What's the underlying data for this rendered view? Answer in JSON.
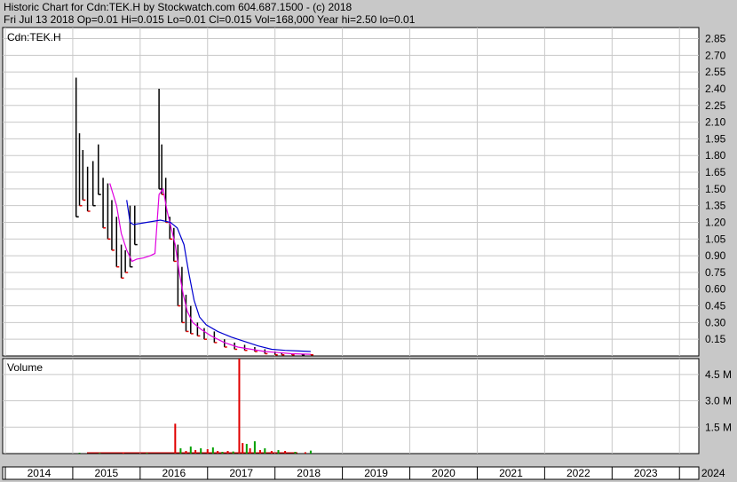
{
  "header": {
    "line1": "Historic Chart for Cdn:TEK.H by Stockwatch.com 604.687.1500 - (c) 2018",
    "line2": "Fri Jul 13 2018   Op=0.01   Hi=0.015   Lo=0.01   Cl=0.015   Vol=168,000   Year hi=2.50   lo=0.01"
  },
  "colors": {
    "background": "#c8c8c8",
    "panel": "#ffffff",
    "grid": "#c8c8c8",
    "price": "#000000",
    "down_tick": "#e00000",
    "ma_short": "#e000e0",
    "ma_long": "#0000d0",
    "vol_up": "#00a000",
    "vol_down": "#e00000"
  },
  "chart_data": [
    {
      "type": "line",
      "title": "Cdn:TEK.H",
      "xlabel": "",
      "ylabel": "",
      "x_ticks": [
        "2014",
        "2015",
        "2016",
        "2017",
        "2018",
        "2019",
        "2020",
        "2021",
        "2022",
        "2023",
        "2024"
      ],
      "y_ticks": [
        "2.85",
        "2.70",
        "2.55",
        "2.40",
        "2.25",
        "2.10",
        "1.95",
        "1.80",
        "1.65",
        "1.50",
        "1.35",
        "1.20",
        "1.05",
        "0.90",
        "0.75",
        "0.60",
        "0.45",
        "0.30",
        "0.15"
      ],
      "ylim": [
        0,
        2.95
      ],
      "grid": true,
      "series": [
        {
          "values_kind": "price_hilo",
          "points": [
            [
              2015.05,
              1.25,
              2.5
            ],
            [
              2015.1,
              1.35,
              2.0
            ],
            [
              2015.15,
              1.4,
              1.85
            ],
            [
              2015.22,
              1.3,
              1.7
            ],
            [
              2015.3,
              1.35,
              1.75
            ],
            [
              2015.38,
              1.45,
              1.9
            ],
            [
              2015.45,
              1.15,
              1.6
            ],
            [
              2015.52,
              1.05,
              1.55
            ],
            [
              2015.58,
              0.95,
              1.4
            ],
            [
              2015.65,
              0.8,
              1.25
            ],
            [
              2015.72,
              0.7,
              1.0
            ],
            [
              2015.78,
              0.75,
              0.95
            ],
            [
              2015.85,
              0.8,
              1.35
            ],
            [
              2015.92,
              1.0,
              1.35
            ],
            [
              2016.28,
              1.5,
              2.4
            ],
            [
              2016.32,
              1.45,
              1.9
            ],
            [
              2016.38,
              1.2,
              1.6
            ],
            [
              2016.44,
              1.05,
              1.25
            ],
            [
              2016.5,
              0.85,
              1.15
            ],
            [
              2016.56,
              0.45,
              1.0
            ],
            [
              2016.62,
              0.3,
              0.8
            ],
            [
              2016.68,
              0.22,
              0.55
            ],
            [
              2016.75,
              0.2,
              0.45
            ],
            [
              2016.85,
              0.18,
              0.3
            ],
            [
              2016.95,
              0.15,
              0.25
            ],
            [
              2017.1,
              0.12,
              0.22
            ],
            [
              2017.25,
              0.08,
              0.15
            ],
            [
              2017.4,
              0.06,
              0.12
            ],
            [
              2017.55,
              0.05,
              0.1
            ],
            [
              2017.7,
              0.04,
              0.08
            ],
            [
              2017.85,
              0.02,
              0.06
            ],
            [
              2018.0,
              0.01,
              0.04
            ],
            [
              2018.1,
              0.01,
              0.03
            ],
            [
              2018.25,
              0.01,
              0.02
            ],
            [
              2018.4,
              0.01,
              0.02
            ],
            [
              2018.53,
              0.01,
              0.015
            ]
          ]
        },
        {
          "name": "",
          "role": "ma_short",
          "points": [
            [
              2015.55,
              1.55
            ],
            [
              2015.65,
              1.35
            ],
            [
              2015.72,
              1.1
            ],
            [
              2015.8,
              0.95
            ],
            [
              2015.88,
              0.85
            ],
            [
              2015.95,
              0.87
            ],
            [
              2016.05,
              0.88
            ],
            [
              2016.15,
              0.9
            ],
            [
              2016.22,
              0.92
            ],
            [
              2016.28,
              1.45
            ],
            [
              2016.34,
              1.5
            ],
            [
              2016.4,
              1.3
            ],
            [
              2016.46,
              1.15
            ],
            [
              2016.52,
              1.0
            ],
            [
              2016.58,
              0.75
            ],
            [
              2016.64,
              0.55
            ],
            [
              2016.7,
              0.4
            ],
            [
              2016.78,
              0.3
            ],
            [
              2016.9,
              0.24
            ],
            [
              2017.05,
              0.18
            ],
            [
              2017.25,
              0.12
            ],
            [
              2017.45,
              0.08
            ],
            [
              2017.65,
              0.06
            ],
            [
              2017.85,
              0.04
            ],
            [
              2018.05,
              0.03
            ],
            [
              2018.25,
              0.02
            ],
            [
              2018.53,
              0.015
            ]
          ]
        },
        {
          "name": "",
          "role": "ma_long",
          "points": [
            [
              2015.8,
              1.4
            ],
            [
              2015.85,
              1.2
            ],
            [
              2015.9,
              1.18
            ],
            [
              2016.1,
              1.2
            ],
            [
              2016.3,
              1.22
            ],
            [
              2016.45,
              1.2
            ],
            [
              2016.55,
              1.15
            ],
            [
              2016.65,
              1.0
            ],
            [
              2016.72,
              0.75
            ],
            [
              2016.8,
              0.5
            ],
            [
              2016.88,
              0.35
            ],
            [
              2016.98,
              0.28
            ],
            [
              2017.15,
              0.22
            ],
            [
              2017.35,
              0.17
            ],
            [
              2017.55,
              0.13
            ],
            [
              2017.75,
              0.09
            ],
            [
              2017.95,
              0.06
            ],
            [
              2018.15,
              0.05
            ],
            [
              2018.35,
              0.045
            ],
            [
              2018.53,
              0.04
            ]
          ]
        }
      ]
    },
    {
      "type": "bar",
      "title": "Volume",
      "y_ticks": [
        "4.5 M",
        "3.0 M",
        "1.5 M"
      ],
      "ylim": [
        0,
        5.4
      ],
      "x_ticks": [
        "2014",
        "2015",
        "2016",
        "2017",
        "2018",
        "2019",
        "2020",
        "2021",
        "2022",
        "2023",
        "2024"
      ],
      "bars": [
        [
          2015.1,
          0.05,
          "up"
        ],
        [
          2015.4,
          0.04,
          "up"
        ],
        [
          2015.75,
          0.05,
          "down"
        ],
        [
          2016.1,
          0.04,
          "up"
        ],
        [
          2016.52,
          1.7,
          "down"
        ],
        [
          2016.6,
          0.3,
          "up"
        ],
        [
          2016.68,
          0.15,
          "down"
        ],
        [
          2016.75,
          0.4,
          "up"
        ],
        [
          2016.82,
          0.2,
          "down"
        ],
        [
          2016.9,
          0.3,
          "up"
        ],
        [
          2017.0,
          0.25,
          "down"
        ],
        [
          2017.08,
          0.35,
          "up"
        ],
        [
          2017.15,
          0.15,
          "down"
        ],
        [
          2017.22,
          0.1,
          "up"
        ],
        [
          2017.3,
          0.15,
          "down"
        ],
        [
          2017.38,
          0.12,
          "up"
        ],
        [
          2017.47,
          5.9,
          "down"
        ],
        [
          2017.52,
          0.6,
          "down"
        ],
        [
          2017.58,
          0.55,
          "up"
        ],
        [
          2017.63,
          0.3,
          "down"
        ],
        [
          2017.7,
          0.7,
          "up"
        ],
        [
          2017.78,
          0.2,
          "down"
        ],
        [
          2017.85,
          0.3,
          "up"
        ],
        [
          2017.95,
          0.15,
          "down"
        ],
        [
          2018.05,
          0.2,
          "up"
        ],
        [
          2018.15,
          0.15,
          "down"
        ],
        [
          2018.3,
          0.1,
          "up"
        ],
        [
          2018.45,
          0.08,
          "down"
        ],
        [
          2018.53,
          0.17,
          "up"
        ]
      ]
    }
  ]
}
